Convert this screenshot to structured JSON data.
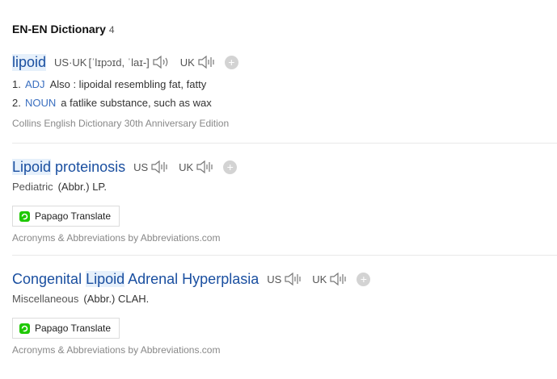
{
  "section": {
    "title": "EN-EN Dictionary",
    "count": "4"
  },
  "entries": [
    {
      "headword": "lipoid",
      "pron_label": "US·UK",
      "phonetic": "[ˈlɪpɔɪd, ˈlaɪ-]",
      "uk_label": "UK",
      "senses": [
        {
          "num": "1.",
          "pos": "ADJ",
          "text": "Also : lipoidal resembling fat, fatty"
        },
        {
          "num": "2.",
          "pos": "NOUN",
          "text": "a fatlike substance, such as wax"
        }
      ],
      "source": "Collins English Dictionary 30th Anniversary Edition"
    },
    {
      "headword_hl": "Lipoid",
      "headword_rest": " proteinosis",
      "us_label": "US",
      "uk_label": "UK",
      "category": "Pediatric",
      "abbr": "(Abbr.) LP.",
      "translate_button": "Papago Translate",
      "source": "Acronyms & Abbreviations by Abbreviations.com"
    },
    {
      "headword_pre": "Congenital ",
      "headword_hl": "Lipoid",
      "headword_rest": " Adrenal Hyperplasia",
      "us_label": "US",
      "uk_label": "UK",
      "category": "Miscellaneous",
      "abbr": "(Abbr.) CLAH.",
      "translate_button": "Papago Translate",
      "source": "Acronyms & Abbreviations by Abbreviations.com"
    }
  ],
  "icons": {
    "speaker": "speaker-icon",
    "add": "plus-icon",
    "papago": "papago-logo-icon"
  },
  "colors": {
    "headword": "#1a4fa0",
    "highlight": "#e6f0fb",
    "pos": "#3a6fc0",
    "papago_green": "#1ec800"
  }
}
